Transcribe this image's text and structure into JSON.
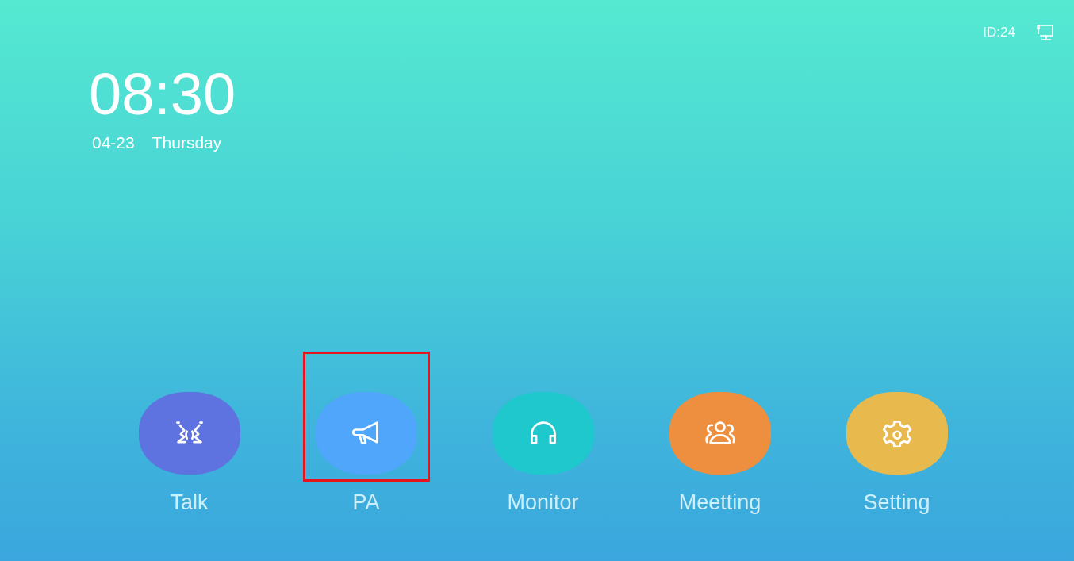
{
  "status_bar": {
    "device_id": "ID:24"
  },
  "clock": {
    "time": "08:30",
    "date": "04-23",
    "weekday": "Thursday"
  },
  "apps": [
    {
      "label": "Talk",
      "kind": "talk",
      "color": "#5e72e0",
      "highlighted": false
    },
    {
      "label": "PA",
      "kind": "pa",
      "color": "#4fa6fb",
      "highlighted": true
    },
    {
      "label": "Monitor",
      "kind": "monitor",
      "color": "#1fc8cc",
      "highlighted": false
    },
    {
      "label": "Meetting",
      "kind": "meeting",
      "color": "#ed8f3e",
      "highlighted": false
    },
    {
      "label": "Setting",
      "kind": "setting",
      "color": "#e8ba4e",
      "highlighted": false
    }
  ]
}
